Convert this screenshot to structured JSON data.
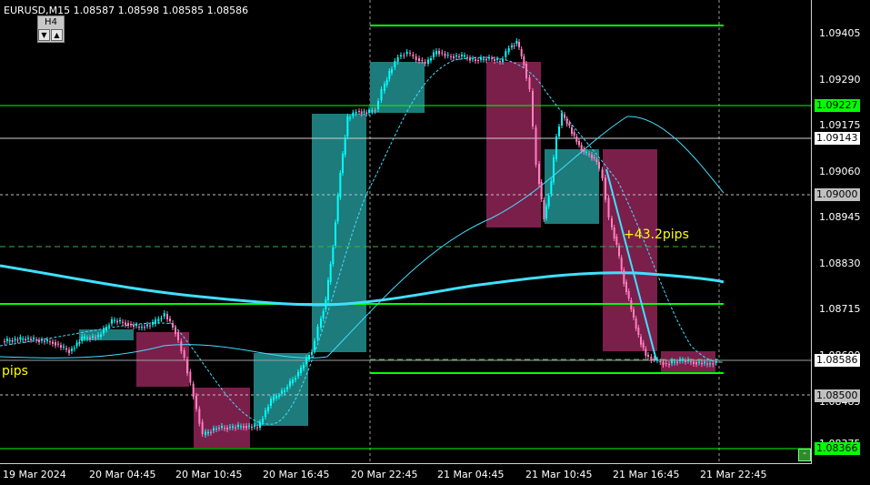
{
  "header": {
    "symbol_line": "EURUSD,M15  1.08587 1.08598 1.08585 1.08586"
  },
  "timeframe": {
    "label": "H4",
    "down": "▼",
    "up": "▲"
  },
  "price_labels": [
    "1.09405",
    "1.09290",
    "1.09175",
    "1.09060",
    "1.08945",
    "1.08830",
    "1.08715",
    "1.08600",
    "1.08485",
    "1.08375"
  ],
  "price_tags": {
    "green_high": "1.09227",
    "white_1": "1.09143",
    "grey_1": "1.09000",
    "current": "1.08586",
    "grey_2": "1.08500",
    "green_low": "1.08366"
  },
  "time_labels": [
    "19 Mar 2024",
    "20 Mar 04:45",
    "20 Mar 10:45",
    "20 Mar 16:45",
    "20 Mar 22:45",
    "21 Mar 04:45",
    "21 Mar 10:45",
    "21 Mar 16:45",
    "21 Mar 22:45"
  ],
  "annotations": {
    "pips_right": "+43.2pips",
    "pips_left": "pips"
  },
  "minus_button": "-",
  "colors": {
    "bull": "#00ffff",
    "bear": "#ff7fbf",
    "bull_box": "#1e7b7b",
    "bear_box": "#7a1f4a",
    "level": "#00ff00",
    "ma": "#40e0ff"
  }
}
